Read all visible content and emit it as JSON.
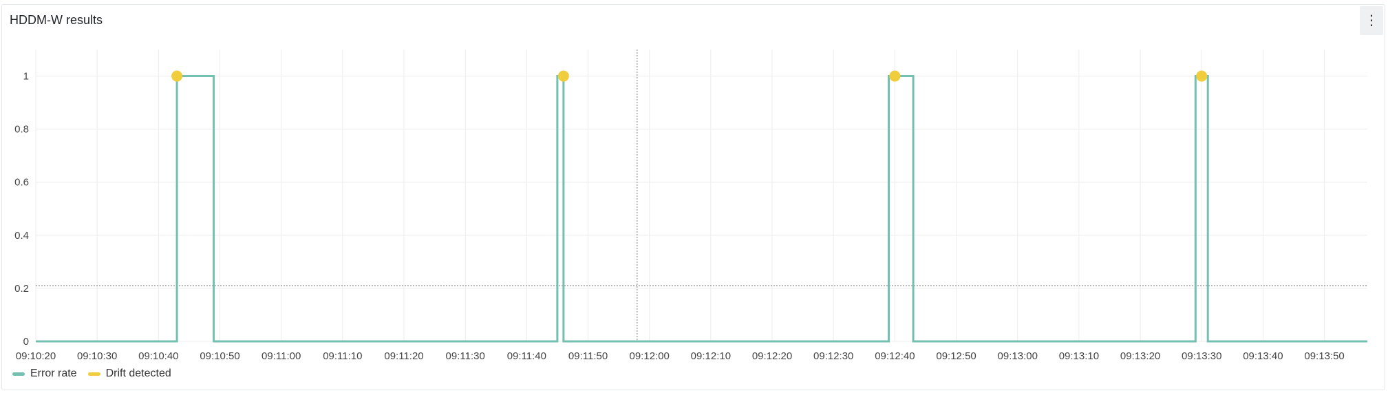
{
  "panel": {
    "title": "HDDM-W results",
    "menu_icon": "vertical-ellipsis-icon"
  },
  "chart_data": {
    "type": "line",
    "title": "HDDM-W results",
    "xlabel": "",
    "ylabel": "",
    "x_axis_type": "time",
    "xlim": [
      "09:10:20",
      "09:13:57"
    ],
    "ylim": [
      0,
      1.1
    ],
    "x_ticks": [
      "09:10:20",
      "09:10:30",
      "09:10:40",
      "09:10:50",
      "09:11:00",
      "09:11:10",
      "09:11:20",
      "09:11:30",
      "09:11:40",
      "09:11:50",
      "09:12:00",
      "09:12:10",
      "09:12:20",
      "09:12:30",
      "09:12:40",
      "09:12:50",
      "09:13:00",
      "09:13:10",
      "09:13:20",
      "09:13:30",
      "09:13:40",
      "09:13:50"
    ],
    "y_ticks": [
      "0",
      "0.2",
      "0.4",
      "0.6",
      "0.8",
      "1"
    ],
    "y_tick_values": [
      0,
      0.2,
      0.4,
      0.6,
      0.8,
      1
    ],
    "grid": true,
    "crosshair": {
      "x": "09:11:58",
      "y": 0.21
    },
    "series": [
      {
        "name": "Error rate",
        "color": "#73bfb0",
        "style": "step",
        "points": [
          [
            "09:10:20",
            0
          ],
          [
            "09:10:43",
            0
          ],
          [
            "09:10:43",
            1
          ],
          [
            "09:10:49",
            1
          ],
          [
            "09:10:49",
            0
          ],
          [
            "09:11:45",
            0
          ],
          [
            "09:11:45",
            1
          ],
          [
            "09:11:46",
            1
          ],
          [
            "09:11:46",
            0
          ],
          [
            "09:12:39",
            0
          ],
          [
            "09:12:39",
            1
          ],
          [
            "09:12:43",
            1
          ],
          [
            "09:12:43",
            0
          ],
          [
            "09:13:29",
            0
          ],
          [
            "09:13:29",
            1
          ],
          [
            "09:13:31",
            1
          ],
          [
            "09:13:31",
            0
          ],
          [
            "09:13:57",
            0
          ]
        ]
      },
      {
        "name": "Drift detected",
        "color": "#f0cd3c",
        "style": "points",
        "points": [
          [
            "09:10:43",
            1
          ],
          [
            "09:11:46",
            1
          ],
          [
            "09:12:40",
            1
          ],
          [
            "09:13:30",
            1
          ]
        ]
      }
    ],
    "legend": [
      "Error rate",
      "Drift detected"
    ],
    "legend_position": "bottom-left"
  }
}
